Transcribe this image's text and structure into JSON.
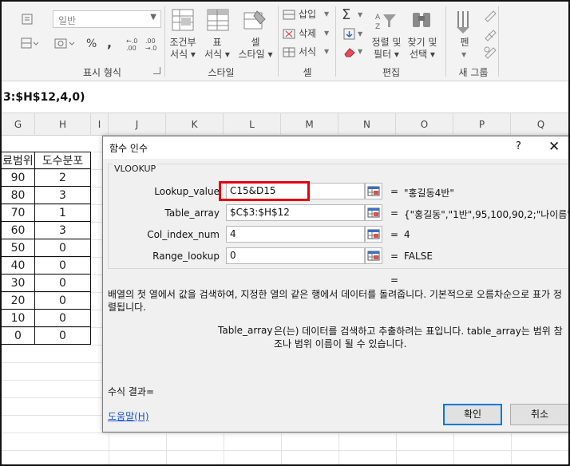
{
  "ribbon": {
    "number_format_value": "일반",
    "number": {
      "percent": "%",
      "comma": ",",
      "inc_decimal": "←.0\n.00",
      "dec_decimal": ".00\n→.0",
      "group_label": "표시 형식"
    },
    "styles": {
      "conditional_line1": "조건부",
      "conditional_line2": "서식 ▾",
      "table_line1": "표",
      "table_line2": "서식 ▾",
      "cell_line1": "셀",
      "cell_line2": "스타일 ▾",
      "group_label": "스타일"
    },
    "cells": {
      "insert": "삽입",
      "delete": "삭제",
      "format": "서식",
      "group_label": "셀"
    },
    "editing": {
      "sort_line1": "정렬 및",
      "sort_line2": "필터 ▾",
      "find_line1": "찾기 및",
      "find_line2": "선택 ▾",
      "group_label": "편집"
    },
    "newgroup": {
      "pen": "펜",
      "group_label": "새 그룹"
    }
  },
  "formula_bar": {
    "text": "3:$H$12,4,0)"
  },
  "columns": [
    "G",
    "H",
    "I",
    "J",
    "K",
    "L",
    "M",
    "N",
    "O",
    "P",
    "Q"
  ],
  "table": {
    "header": {
      "g": "료범위",
      "h": "도수분포"
    },
    "rows": [
      {
        "g": "90",
        "h": "2"
      },
      {
        "g": "80",
        "h": "3"
      },
      {
        "g": "70",
        "h": "1"
      },
      {
        "g": "60",
        "h": "3"
      },
      {
        "g": "50",
        "h": "0"
      },
      {
        "g": "40",
        "h": "0"
      },
      {
        "g": "30",
        "h": "0"
      },
      {
        "g": "20",
        "h": "0"
      },
      {
        "g": "10",
        "h": "0"
      },
      {
        "g": "0",
        "h": "0"
      }
    ]
  },
  "dialog": {
    "title": "함수 인수",
    "help_glyph": "?",
    "close_glyph": "✕",
    "function_name": "VLOOKUP",
    "args": [
      {
        "label": "Lookup_value",
        "input": "C15&D15",
        "eq": "=",
        "value": "\"홍길동4반\""
      },
      {
        "label": "Table_array",
        "input": "$C$3:$H$12",
        "eq": "=",
        "value": "{\"홍길동\",\"1반\",95,100,90,2;\"나이름\""
      },
      {
        "label": "Col_index_num",
        "input": "4",
        "eq": "=",
        "value": "4"
      },
      {
        "label": "Range_lookup",
        "input": "0",
        "eq": "=",
        "value": "FALSE"
      }
    ],
    "result_eq": "=",
    "description": "배열의 첫 열에서 값을 검색하여, 지정한 열의 같은 행에서 데이터를 돌려줍니다. 기본적으로 오름차순으로 표가 정렬됩니다.",
    "arg_desc_name": "Table_array",
    "arg_desc_text": "은(는) 데이터를 검색하고 추출하려는 표입니다. table_array는 범위 참조나 범위 이름이 될 수 있습니다.",
    "formula_result_label": "수식 결과=",
    "help_link": "도움말(H)",
    "ok_label": "확인",
    "cancel_label": "취소"
  },
  "colors": {
    "accent": "#0078d7",
    "highlight": "#e3000f",
    "link": "#1a55c6"
  }
}
